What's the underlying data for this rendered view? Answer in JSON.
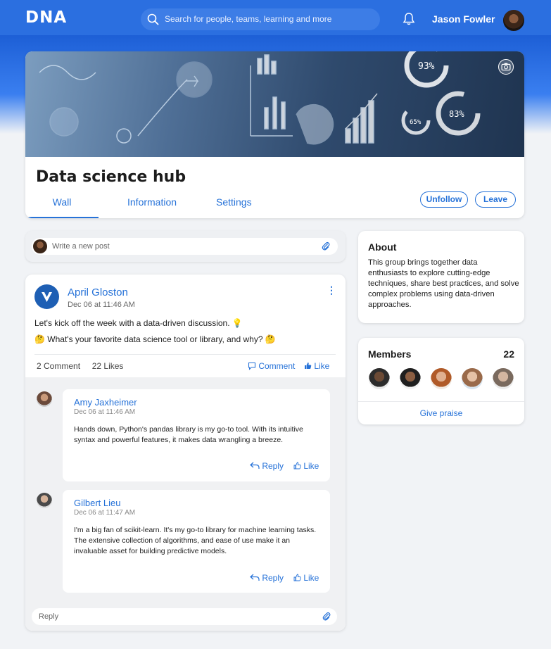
{
  "app": {
    "logo": "DNA"
  },
  "search": {
    "placeholder": "Search for people, teams, learning and more"
  },
  "user": {
    "name": "Jason Fowler"
  },
  "group": {
    "title": "Data science hub",
    "tabs": [
      {
        "label": "Wall",
        "active": true
      },
      {
        "label": "Information",
        "active": false
      },
      {
        "label": "Settings",
        "active": false
      }
    ],
    "unfollow_label": "Unfollow",
    "leave_label": "Leave",
    "banner_stats": [
      "93%",
      "65%",
      "83%"
    ]
  },
  "composer": {
    "placeholder": "Write a new post"
  },
  "post": {
    "author": "April Gloston",
    "time": "Dec 06 at 11:46 AM",
    "line1": "Let's kick off the week with a data-driven discussion. 💡",
    "line2": "🤔 What's your favorite data science tool or library, and why? 🤔",
    "comment_count": "2 Comment",
    "like_count": "22 Likes",
    "comment_label": "Comment",
    "like_label": "Like"
  },
  "comments": [
    {
      "author": "Amy Jaxheimer",
      "time": "Dec 06 at 11:46 AM",
      "text": "Hands down, Python's pandas library is my go-to tool. With its intuitive syntax and powerful features, it makes data wrangling a breeze.",
      "reply_label": "Reply",
      "like_label": "Like"
    },
    {
      "author": "Gilbert Lieu",
      "time": "Dec 06 at 11:47 AM",
      "text": "I'm a big fan of scikit-learn. It's my go-to library for machine learning tasks. The extensive collection of algorithms, and ease of use make it an invaluable asset for building predictive models.",
      "reply_label": "Reply",
      "like_label": "Like"
    }
  ],
  "reply_box": {
    "placeholder": "Reply"
  },
  "about": {
    "title": "About",
    "text": "This group brings together data enthusiasts to explore cutting-edge techniques, share best practices, and solve complex problems using data-driven approaches."
  },
  "members": {
    "title": "Members",
    "count": "22",
    "praise_label": "Give praise"
  },
  "colors": {
    "brand": "#2b6fe0",
    "link": "#2672d8",
    "background": "#f1f3f6"
  }
}
